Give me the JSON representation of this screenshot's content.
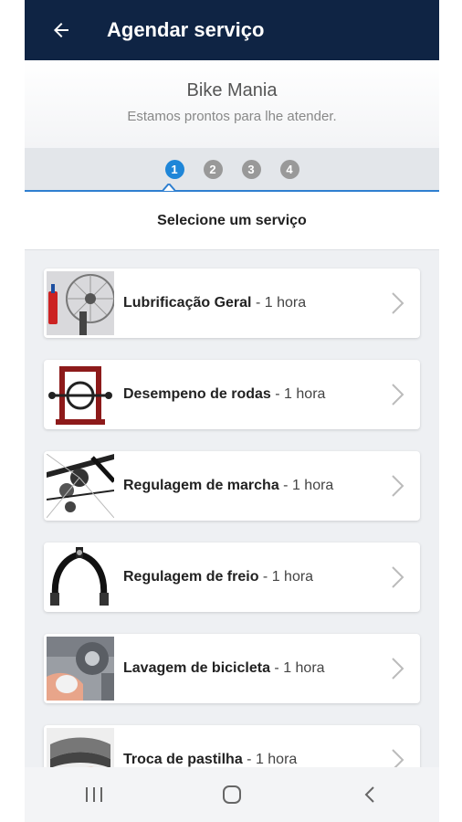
{
  "header": {
    "title": "Agendar serviço",
    "back_icon": "arrow-left-icon"
  },
  "store": {
    "name": "Bike Mania",
    "tagline": "Estamos prontos para lhe atender."
  },
  "steps": [
    {
      "label": "1",
      "active": true
    },
    {
      "label": "2",
      "active": false
    },
    {
      "label": "3",
      "active": false
    },
    {
      "label": "4",
      "active": false
    }
  ],
  "section_title": "Selecione um serviço",
  "services": [
    {
      "name": "Lubrificação Geral",
      "duration": " - 1 hora"
    },
    {
      "name": "Desempeno de rodas",
      "duration": " - 1 hora"
    },
    {
      "name": "Regulagem de marcha",
      "duration": " - 1 hora"
    },
    {
      "name": "Regulagem de freio",
      "duration": " - 1 hora"
    },
    {
      "name": "Lavagem de bicicleta",
      "duration": " - 1 hora"
    },
    {
      "name": "Troca de pastilha",
      "duration": " - 1 hora"
    }
  ],
  "navbar": [
    "recent-apps-icon",
    "home-icon",
    "back-nav-icon"
  ],
  "colors": {
    "appbar": "#0f2444",
    "accent": "#1f86d8",
    "inactive_step": "#999999"
  }
}
